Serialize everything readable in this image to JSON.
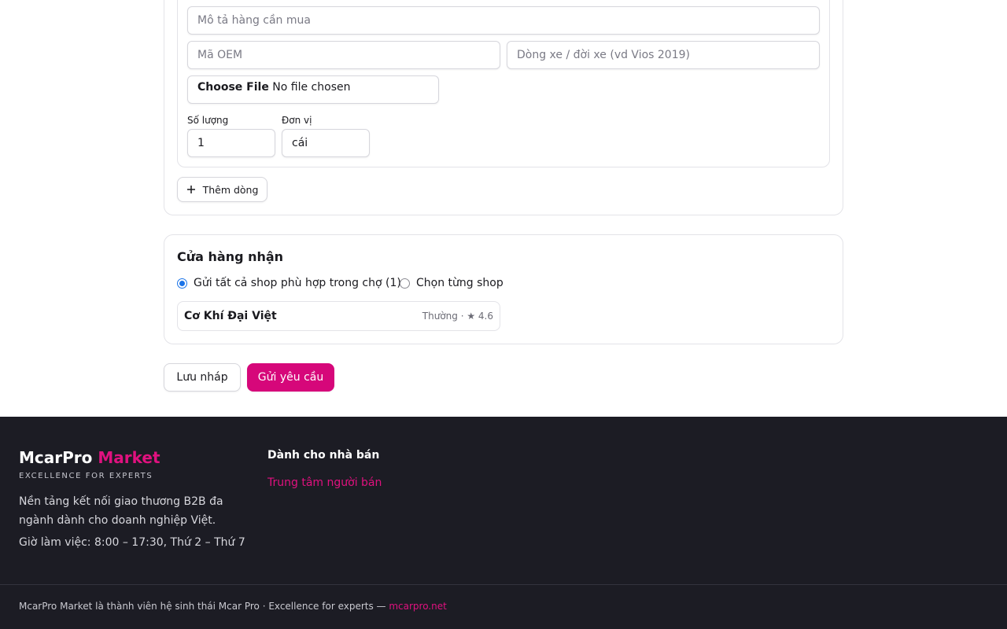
{
  "form": {
    "description_placeholder": "Mô tả hàng cần mua",
    "oem_placeholder": "Mã OEM",
    "vehicle_placeholder": "Dòng xe / đời xe (vd Vios 2019)",
    "file_button_label": "Choose File",
    "file_status": "No file chosen",
    "quantity_label": "Số lượng",
    "quantity_value": "1",
    "unit_label": "Đơn vị",
    "unit_value": "cái",
    "add_row_icon": "plus-icon",
    "add_row_label": "Thêm dòng"
  },
  "receiving_shops": {
    "title": "Cửa hàng nhận",
    "option_all_label": "Gửi tất cả shop phù hợp trong chợ (1)",
    "option_all_selected": true,
    "option_pick_label": "Chọn từng shop",
    "option_pick_selected": false,
    "shops": [
      {
        "name": "Cơ Khí Đại Việt",
        "meta": "Thường · ★ 4.6"
      }
    ]
  },
  "actions": {
    "save_draft_label": "Lưu nháp",
    "submit_label": "Gửi yêu cầu"
  },
  "footer": {
    "brand_primary": "McarPro",
    "brand_accent": "Market",
    "tagline": "EXCELLENCE FOR EXPERTS",
    "description": "Nền tảng kết nối giao thương B2B đa ngành dành cho doanh nghiệp Việt.",
    "hours": "Giờ làm việc: 8:00 – 17:30, Thứ 2 – Thứ 7",
    "sellers_title": "Dành cho nhà bán",
    "sellers_link": "Trung tâm người bán",
    "copyright_text": "McarPro Market là thành viên hệ sinh thái Mcar Pro · Excellence for experts — ",
    "copyright_link": "mcarpro.net"
  },
  "colors": {
    "accent": "#d6077a",
    "footer_bg": "#1c1c24",
    "radio_checked": "#1a73e8"
  }
}
